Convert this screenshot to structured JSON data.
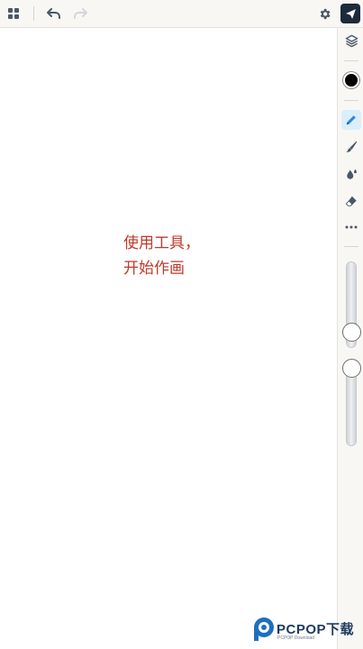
{
  "toolbar": {
    "icons": {
      "grid": "grid-icon",
      "undo": "undo-icon",
      "redo": "redo-icon",
      "settings": "gear-icon",
      "send": "send-icon"
    }
  },
  "canvas": {
    "hint_line1": "使用工具，",
    "hint_line2": "开始作画"
  },
  "sidebar": {
    "tools": [
      "layers-icon",
      "color-swatch",
      "pencil-icon",
      "brush-icon",
      "ink-drops-icon",
      "eraser-icon",
      "more-icon"
    ],
    "active_tool": "pencil",
    "current_color": "#000000",
    "size_slider_value": 0.0,
    "opacity_slider_value": 1.0
  },
  "watermark": {
    "brand": "PCPOP下载",
    "sub": "PCPOP Download"
  },
  "colors": {
    "accent_blue": "#2f86d6",
    "hint_red": "#c0392b",
    "send_bg": "#1c2a3a"
  }
}
